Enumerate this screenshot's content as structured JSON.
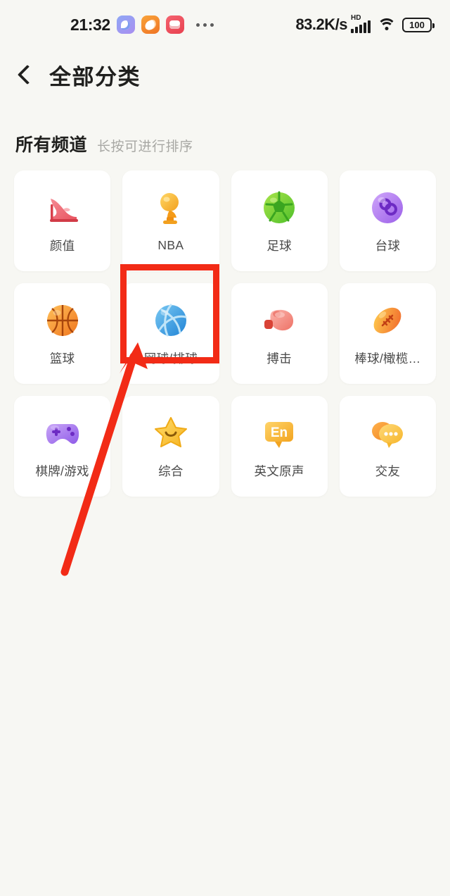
{
  "status_bar": {
    "time": "21:32",
    "app_icons": [
      "messenger-app-icon",
      "bird-app-icon",
      "group-app-icon"
    ],
    "overflow": "more-apps-dots",
    "network_speed": "83.2K/s",
    "hd_label": "HD",
    "signal": "signal-bars-icon",
    "wifi": "wifi-icon",
    "battery_level": "100"
  },
  "nav": {
    "back_icon": "back-chevron-icon",
    "title": "全部分类"
  },
  "section": {
    "title": "所有频道",
    "hint": "长按可进行排序"
  },
  "categories": [
    {
      "label": "颜值",
      "icon": "high-heel-icon"
    },
    {
      "label": "NBA",
      "icon": "trophy-icon"
    },
    {
      "label": "足球",
      "icon": "soccer-ball-icon"
    },
    {
      "label": "台球",
      "icon": "billiard-eight-ball-icon"
    },
    {
      "label": "篮球",
      "icon": "basketball-icon"
    },
    {
      "label": "网球/排球",
      "icon": "volleyball-icon"
    },
    {
      "label": "搏击",
      "icon": "boxing-glove-icon"
    },
    {
      "label": "棒球/橄榄…",
      "icon": "football-icon"
    },
    {
      "label": "棋牌/游戏",
      "icon": "gamepad-icon"
    },
    {
      "label": "综合",
      "icon": "smiling-star-icon"
    },
    {
      "label": "英文原声",
      "icon": "en-bubble-icon"
    },
    {
      "label": "交友",
      "icon": "chat-bubbles-icon"
    }
  ],
  "annotations": {
    "highlight_target": "网球/排球",
    "highlight_color": "#f22b16",
    "arrow_color": "#f22b16"
  }
}
